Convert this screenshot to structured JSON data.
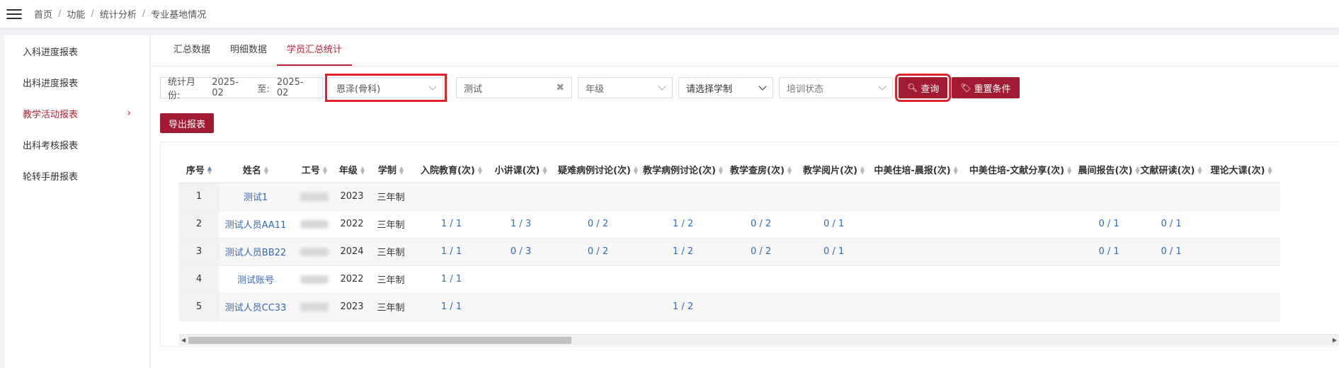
{
  "breadcrumb": [
    "首页",
    "功能",
    "统计分析",
    "专业基地情况"
  ],
  "sidebar": {
    "items": [
      {
        "label": "入科进度报表"
      },
      {
        "label": "出科进度报表"
      },
      {
        "label": "教学活动报表"
      },
      {
        "label": "出科考核报表"
      },
      {
        "label": "轮转手册报表"
      }
    ]
  },
  "tabs": [
    {
      "label": "汇总数据"
    },
    {
      "label": "明细数据"
    },
    {
      "label": "学员汇总统计"
    }
  ],
  "filters": {
    "month_label": "统计月份:",
    "month_from": "2025-02",
    "to_label": "至:",
    "month_to": "2025-02",
    "department": "恩泽(骨科)",
    "keyword": "测试",
    "grade_placeholder": "年级",
    "system_placeholder": "请选择学制",
    "status_placeholder": "培训状态",
    "search_label": "查询",
    "reset_label": "重置条件",
    "export_label": "导出报表"
  },
  "table": {
    "columns": [
      "序号",
      "姓名",
      "工号",
      "年级",
      "学制",
      "入院教育(次)",
      "小讲课(次)",
      "疑难病例讨论(次)",
      "教学病例讨论(次)",
      "教学查房(次)",
      "教学阅片(次)",
      "中美住培-晨报(次)",
      "中美住培-文献分享(次)",
      "晨间报告(次)",
      "文献研读(次)",
      "理论大课(次)"
    ],
    "rows": [
      [
        "1",
        "测试1",
        "",
        "2023",
        "三年制",
        "",
        "",
        "",
        "",
        "",
        "",
        "",
        "",
        "",
        "",
        ""
      ],
      [
        "2",
        "测试人员AA11",
        "",
        "2022",
        "三年制",
        "1 / 1",
        "1 / 3",
        "0 / 2",
        "1 / 2",
        "0 / 2",
        "0 / 1",
        "",
        "",
        "0 / 1",
        "0 / 1",
        ""
      ],
      [
        "3",
        "测试人员BB22",
        "",
        "2024",
        "三年制",
        "1 / 1",
        "0 / 3",
        "0 / 2",
        "1 / 2",
        "0 / 2",
        "0 / 1",
        "",
        "",
        "0 / 1",
        "0 / 1",
        ""
      ],
      [
        "4",
        "测试账号",
        "",
        "2022",
        "三年制",
        "1 / 1",
        "",
        "",
        "",
        "",
        "",
        "",
        "",
        "",
        "",
        ""
      ],
      [
        "5",
        "测试人员CC33",
        "",
        "2023",
        "三年制",
        "1 / 1",
        "",
        "",
        "1 / 2",
        "",
        "",
        "",
        "",
        "",
        "",
        ""
      ]
    ]
  },
  "colors": {
    "accent": "#a21b33",
    "link": "#3568b5",
    "highlight": "#e0232a"
  }
}
